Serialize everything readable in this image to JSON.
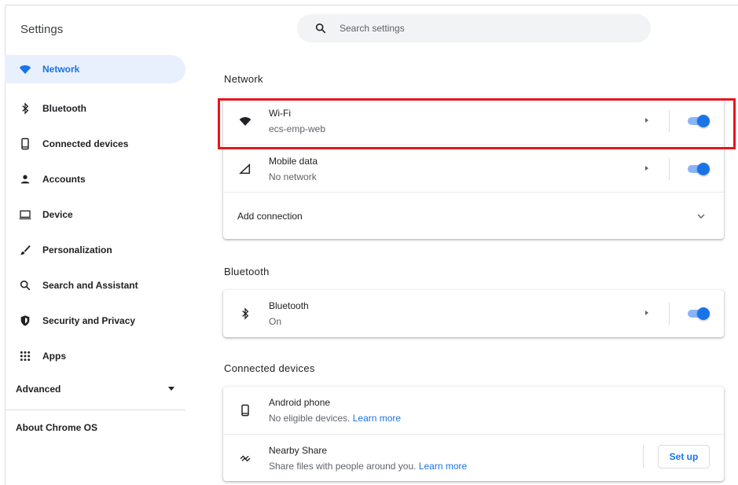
{
  "app": {
    "title": "Settings"
  },
  "search": {
    "placeholder": "Search settings"
  },
  "sidebar": {
    "items": [
      {
        "label": "Network",
        "icon": "wifi-icon",
        "active": true
      },
      {
        "label": "Bluetooth",
        "icon": "bluetooth-icon"
      },
      {
        "label": "Connected devices",
        "icon": "phone-icon"
      },
      {
        "label": "Accounts",
        "icon": "person-icon"
      },
      {
        "label": "Device",
        "icon": "laptop-icon"
      },
      {
        "label": "Personalization",
        "icon": "brush-icon"
      },
      {
        "label": "Search and Assistant",
        "icon": "search-icon"
      },
      {
        "label": "Security and Privacy",
        "icon": "shield-icon"
      },
      {
        "label": "Apps",
        "icon": "apps-grid-icon"
      }
    ],
    "advanced_label": "Advanced",
    "about_label": "About Chrome OS"
  },
  "network": {
    "title": "Network",
    "wifi": {
      "name": "Wi-Fi",
      "status": "ecs-emp-web",
      "enabled": true
    },
    "mobile": {
      "name": "Mobile data",
      "status": "No network",
      "enabled": true
    },
    "add_connection": "Add connection"
  },
  "bluetooth": {
    "title": "Bluetooth",
    "row": {
      "name": "Bluetooth",
      "status": "On",
      "enabled": true
    }
  },
  "connected": {
    "title": "Connected devices",
    "android": {
      "name": "Android phone",
      "status": "No eligible devices.",
      "link": "Learn more"
    },
    "nearby": {
      "name": "Nearby Share",
      "status": "Share files with people around you.",
      "link": "Learn more",
      "button": "Set up"
    }
  },
  "colors": {
    "accent": "#1a73e8",
    "highlight": "#e8141c",
    "active_bg": "#e8f0fe"
  }
}
